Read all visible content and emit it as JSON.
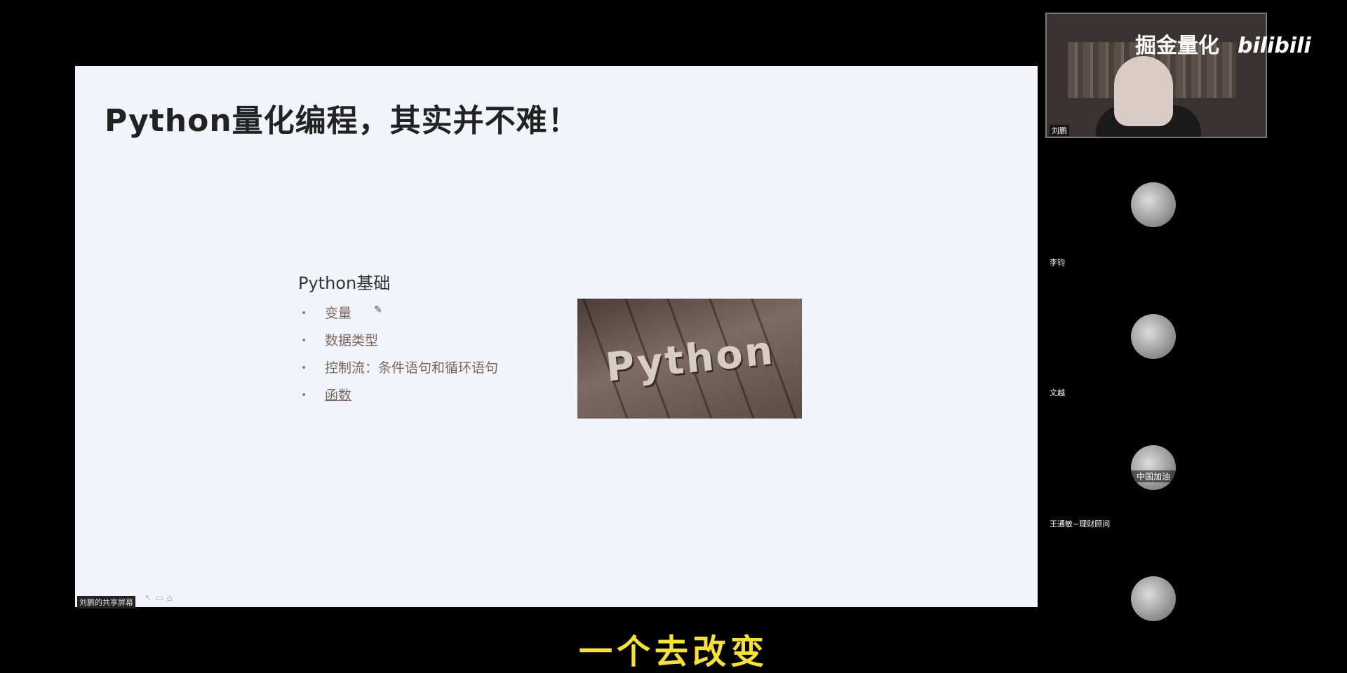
{
  "slide": {
    "title": "Python量化编程，其实并不难！",
    "section_title": "Python基础",
    "bullets": [
      "变量",
      "数据类型",
      "控制流：条件语句和循环语句",
      "函数"
    ],
    "image_text": "Python"
  },
  "share_bar": {
    "label": "刘鹏的共享屏幕"
  },
  "video": {
    "presenter_name": "刘鹏",
    "watermark": "掘金量化",
    "logo": "bilibili"
  },
  "participants": [
    {
      "name": "李钧",
      "avatar_text": ""
    },
    {
      "name": "文越",
      "avatar_text": ""
    },
    {
      "name": "王通敏~理财顾问",
      "avatar_text": "中国加油"
    },
    {
      "name": "",
      "avatar_text": ""
    }
  ],
  "subtitle": "一个去改变"
}
